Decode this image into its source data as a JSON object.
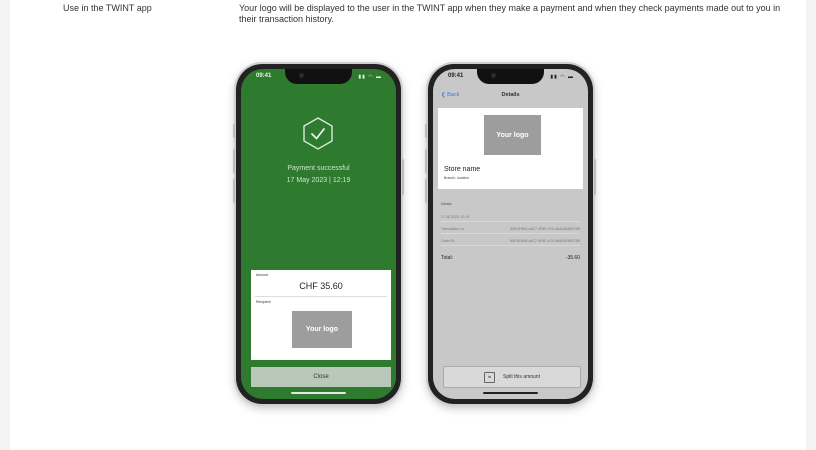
{
  "row": {
    "label": "Use in the TWINT app",
    "description": "Your logo will be displayed to the user in the TWINT app when they make a payment and when they check payments made out to you in their transaction history."
  },
  "phone_payment": {
    "time": "09:41",
    "status_icons": "signal wifi battery",
    "success_title": "Payment successful",
    "success_date": "17 May 2023 | 12:19",
    "amount_label": "Amount",
    "amount": "CHF 35.60",
    "recipient_label": "Recipient",
    "logo": "Your logo",
    "close": "Close",
    "colors": {
      "background": "#2e7a2e",
      "logo": "#9d9d9d"
    }
  },
  "phone_details": {
    "time": "09:41",
    "back": "Back",
    "title": "Details",
    "logo": "Your logo",
    "store_name": "Store name",
    "store_sub": "Branch, location",
    "details_label": "Details",
    "date_line": "17.05.2023, 12:19",
    "tx_label": "Transaction no.",
    "tx_value": "A0E0F6EA-a4C7-4F6F-a7A-3A4A3D6E2789",
    "order_label": "Order ID",
    "order_value": "A6F5E6EA-a4C7-4F6F-a7A-3A4A3D6E2789",
    "total_label": "Total:",
    "total_value": "-35.60",
    "split": "Split this amount"
  }
}
